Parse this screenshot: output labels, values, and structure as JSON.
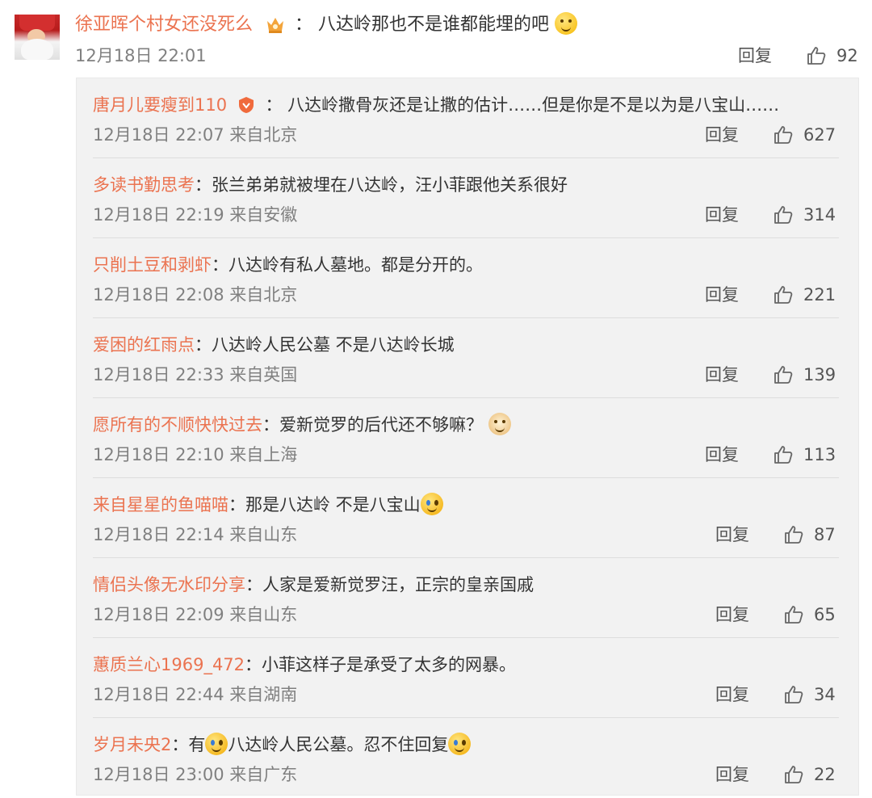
{
  "main_comment": {
    "username": "徐亚晖个村女还没死么",
    "colon": "：",
    "text": "八达岭那也不是谁都能埋的吧",
    "emoji": "smirk-emoji",
    "meta": "12月18日 22:01",
    "reply_label": "回复",
    "likes": "92"
  },
  "replies": [
    {
      "username": "唐月儿要瘦到110",
      "colon": "：",
      "text": "八达岭撒骨灰还是让撒的估计……但是你是不是以为是八宝山……",
      "meta": "12月18日 22:07 来自北京",
      "reply_label": "回复",
      "likes": "627"
    },
    {
      "username": "多读书勤思考",
      "colon": "：",
      "text": "张兰弟弟就被埋在八达岭，汪小菲跟他关系很好",
      "meta": "12月18日 22:19 来自安徽",
      "reply_label": "回复",
      "likes": "314"
    },
    {
      "username": "只削土豆和剥虾",
      "colon": "：",
      "text": "八达岭有私人墓地。都是分开的。",
      "meta": "12月18日 22:08 来自北京",
      "reply_label": "回复",
      "likes": "221"
    },
    {
      "username": "爱困的红雨点",
      "colon": "：",
      "text": "八达岭人民公墓 不是八达岭长城",
      "meta": "12月18日 22:33 来自英国",
      "reply_label": "回复",
      "likes": "139"
    },
    {
      "username": "愿所有的不顺快快过去",
      "colon": "：",
      "text": "爱新觉罗的后代还不够嘛？",
      "meta": "12月18日 22:10 来自上海",
      "reply_label": "回复",
      "likes": "113"
    },
    {
      "username": "来自星星的鱼喵喵",
      "colon": "：",
      "text": "那是八达岭 不是八宝山",
      "meta": "12月18日 22:14 来自山东",
      "reply_label": "回复",
      "likes": "87"
    },
    {
      "username": "情侣头像无水印分享",
      "colon": "：",
      "text": "人家是爱新觉罗汪，正宗的皇亲国戚",
      "meta": "12月18日 22:09 来自山东",
      "reply_label": "回复",
      "likes": "65"
    },
    {
      "username": "蕙质兰心1969_472",
      "colon": "：",
      "text": "小菲这样子是承受了太多的网暴。",
      "meta": "12月18日 22:44 来自湖南",
      "reply_label": "回复",
      "likes": "34"
    },
    {
      "username": "岁月未央2",
      "colon": "：",
      "text_a": "有",
      "text_b": "八达岭人民公墓。忍不住回复",
      "meta": "12月18日 23:00 来自广东",
      "reply_label": "回复",
      "likes": "22"
    }
  ],
  "colors": {
    "username": "#eb7350",
    "text": "#333333",
    "meta": "#808080",
    "reply_bg": "#f2f2f2"
  }
}
